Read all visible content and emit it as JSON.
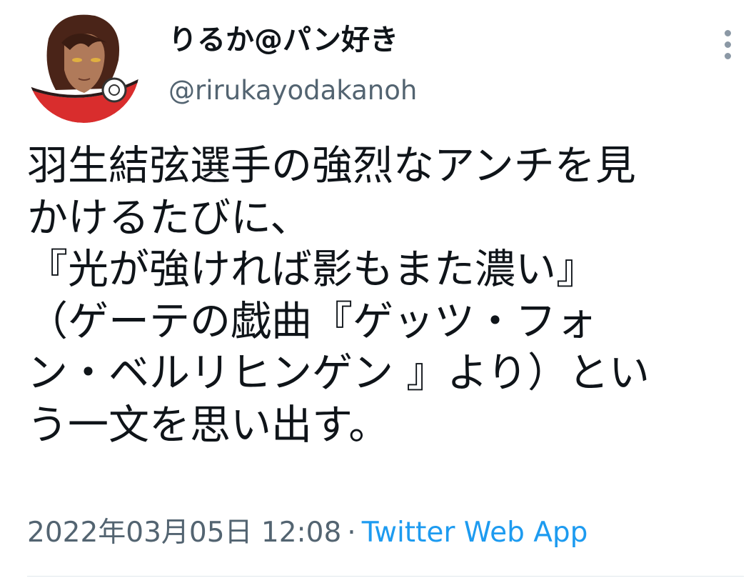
{
  "author": {
    "display_name": "りるか@パン好き",
    "handle": "@rirukayodakanoh",
    "avatar_icon": "user-avatar-icon"
  },
  "menu": {
    "icon": "more-vertical-icon"
  },
  "tweet": {
    "lines": [
      "羽生結弦選手の強烈なアンチを見",
      "かけるたびに、",
      "『光が強ければ影もまた濃い』",
      "（ゲーテの戯曲『ゲッツ・フォ",
      "ン・ベルリヒンゲン 』より）とい",
      "う一文を思い出す。"
    ]
  },
  "meta": {
    "datetime": "2022年03月05日 12:08",
    "separator": "·",
    "source": "Twitter Web App"
  },
  "colors": {
    "text_primary": "#0f1419",
    "text_secondary": "#536471",
    "link": "#1d9bf0",
    "divider": "#e1e8ed"
  }
}
